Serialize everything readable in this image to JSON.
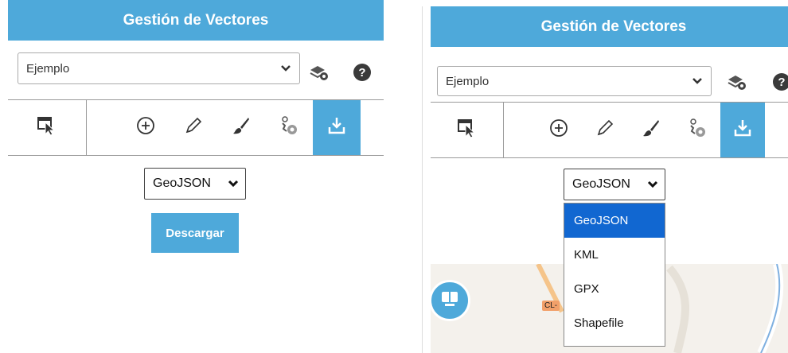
{
  "panel_a": {
    "header": {
      "title": "Gestión de Vectores"
    },
    "layer_select": {
      "value": "Ejemplo"
    },
    "format_select": {
      "value": "GeoJSON"
    },
    "download_button": {
      "label": "Descargar"
    }
  },
  "panel_b": {
    "header": {
      "title": "Gestión de Vectores"
    },
    "layer_select": {
      "value": "Ejemplo"
    },
    "format_select": {
      "value": "GeoJSON",
      "options": [
        "GeoJSON",
        "KML",
        "GPX",
        "Shapefile"
      ]
    },
    "map": {
      "road_label": "CL-"
    }
  },
  "icons": {
    "layers_settings": "layers-gear-icon",
    "help": "help-icon",
    "select": "select-cursor-icon",
    "add": "add-circle-icon",
    "edit": "pencil-icon",
    "style": "brush-icon",
    "attributes": "feature-attributes-icon",
    "download": "download-icon",
    "map_widget": "map-widget-icon"
  },
  "glyphs": {
    "help": "?",
    "chevron": "⌄",
    "bold_chevron": "⌄"
  },
  "colors": {
    "accent": "#4ea9da",
    "selected_option": "#1167d1"
  }
}
